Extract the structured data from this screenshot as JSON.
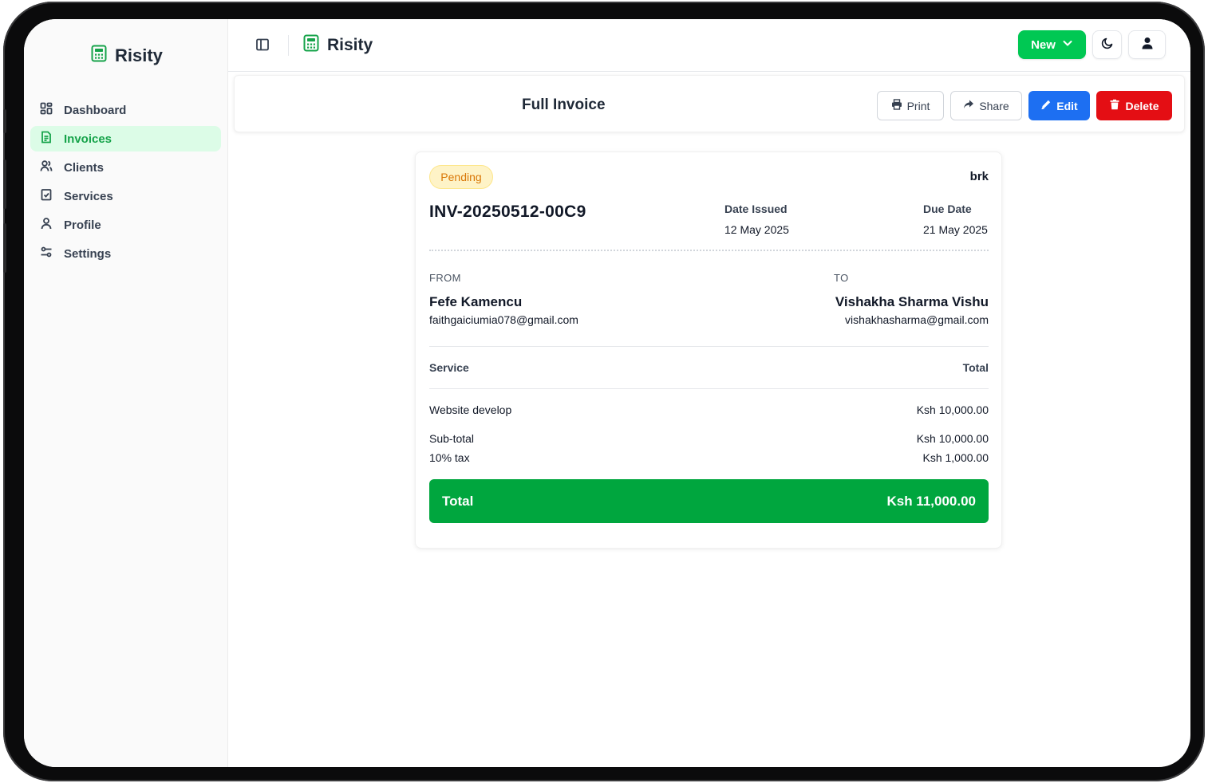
{
  "app": {
    "name": "Risity"
  },
  "sidebar": {
    "items": [
      {
        "label": "Dashboard",
        "icon": "dashboard-icon"
      },
      {
        "label": "Invoices",
        "icon": "invoice-icon",
        "active": true
      },
      {
        "label": "Clients",
        "icon": "users-icon"
      },
      {
        "label": "Services",
        "icon": "clipboard-check-icon"
      },
      {
        "label": "Profile",
        "icon": "user-icon"
      },
      {
        "label": "Settings",
        "icon": "sliders-icon"
      }
    ]
  },
  "header": {
    "new_label": "New",
    "theme_icon": "moon-icon",
    "account_icon": "user-icon"
  },
  "page": {
    "title": "Full Invoice",
    "actions": {
      "print": "Print",
      "share": "Share",
      "edit": "Edit",
      "delete": "Delete"
    }
  },
  "invoice": {
    "status": "Pending",
    "company": "brk",
    "number": "INV-20250512-00C9",
    "date_issued_label": "Date Issued",
    "date_issued": "12 May 2025",
    "due_date_label": "Due Date",
    "due_date": "21 May 2025",
    "from": {
      "label": "FROM",
      "name": "Fefe Kamencu",
      "email": "faithgaiciumia078@gmail.com"
    },
    "to": {
      "label": "TO",
      "name": "Vishakha Sharma Vishu",
      "email": "vishakhasharma@gmail.com"
    },
    "columns": {
      "service": "Service",
      "total": "Total"
    },
    "items": [
      {
        "service": "Website develop",
        "total": "Ksh 10,000.00"
      }
    ],
    "subtotal_label": "Sub-total",
    "subtotal": "Ksh 10,000.00",
    "tax_label": "10% tax",
    "tax": "Ksh 1,000.00",
    "total_label": "Total",
    "total": "Ksh 11,000.00"
  },
  "colors": {
    "brand_green": "#00c853",
    "total_green": "#00a63e",
    "edit_blue": "#1d6ff2",
    "delete_red": "#e40e14",
    "pending_bg": "#fef3c7",
    "pending_text": "#d97706"
  }
}
